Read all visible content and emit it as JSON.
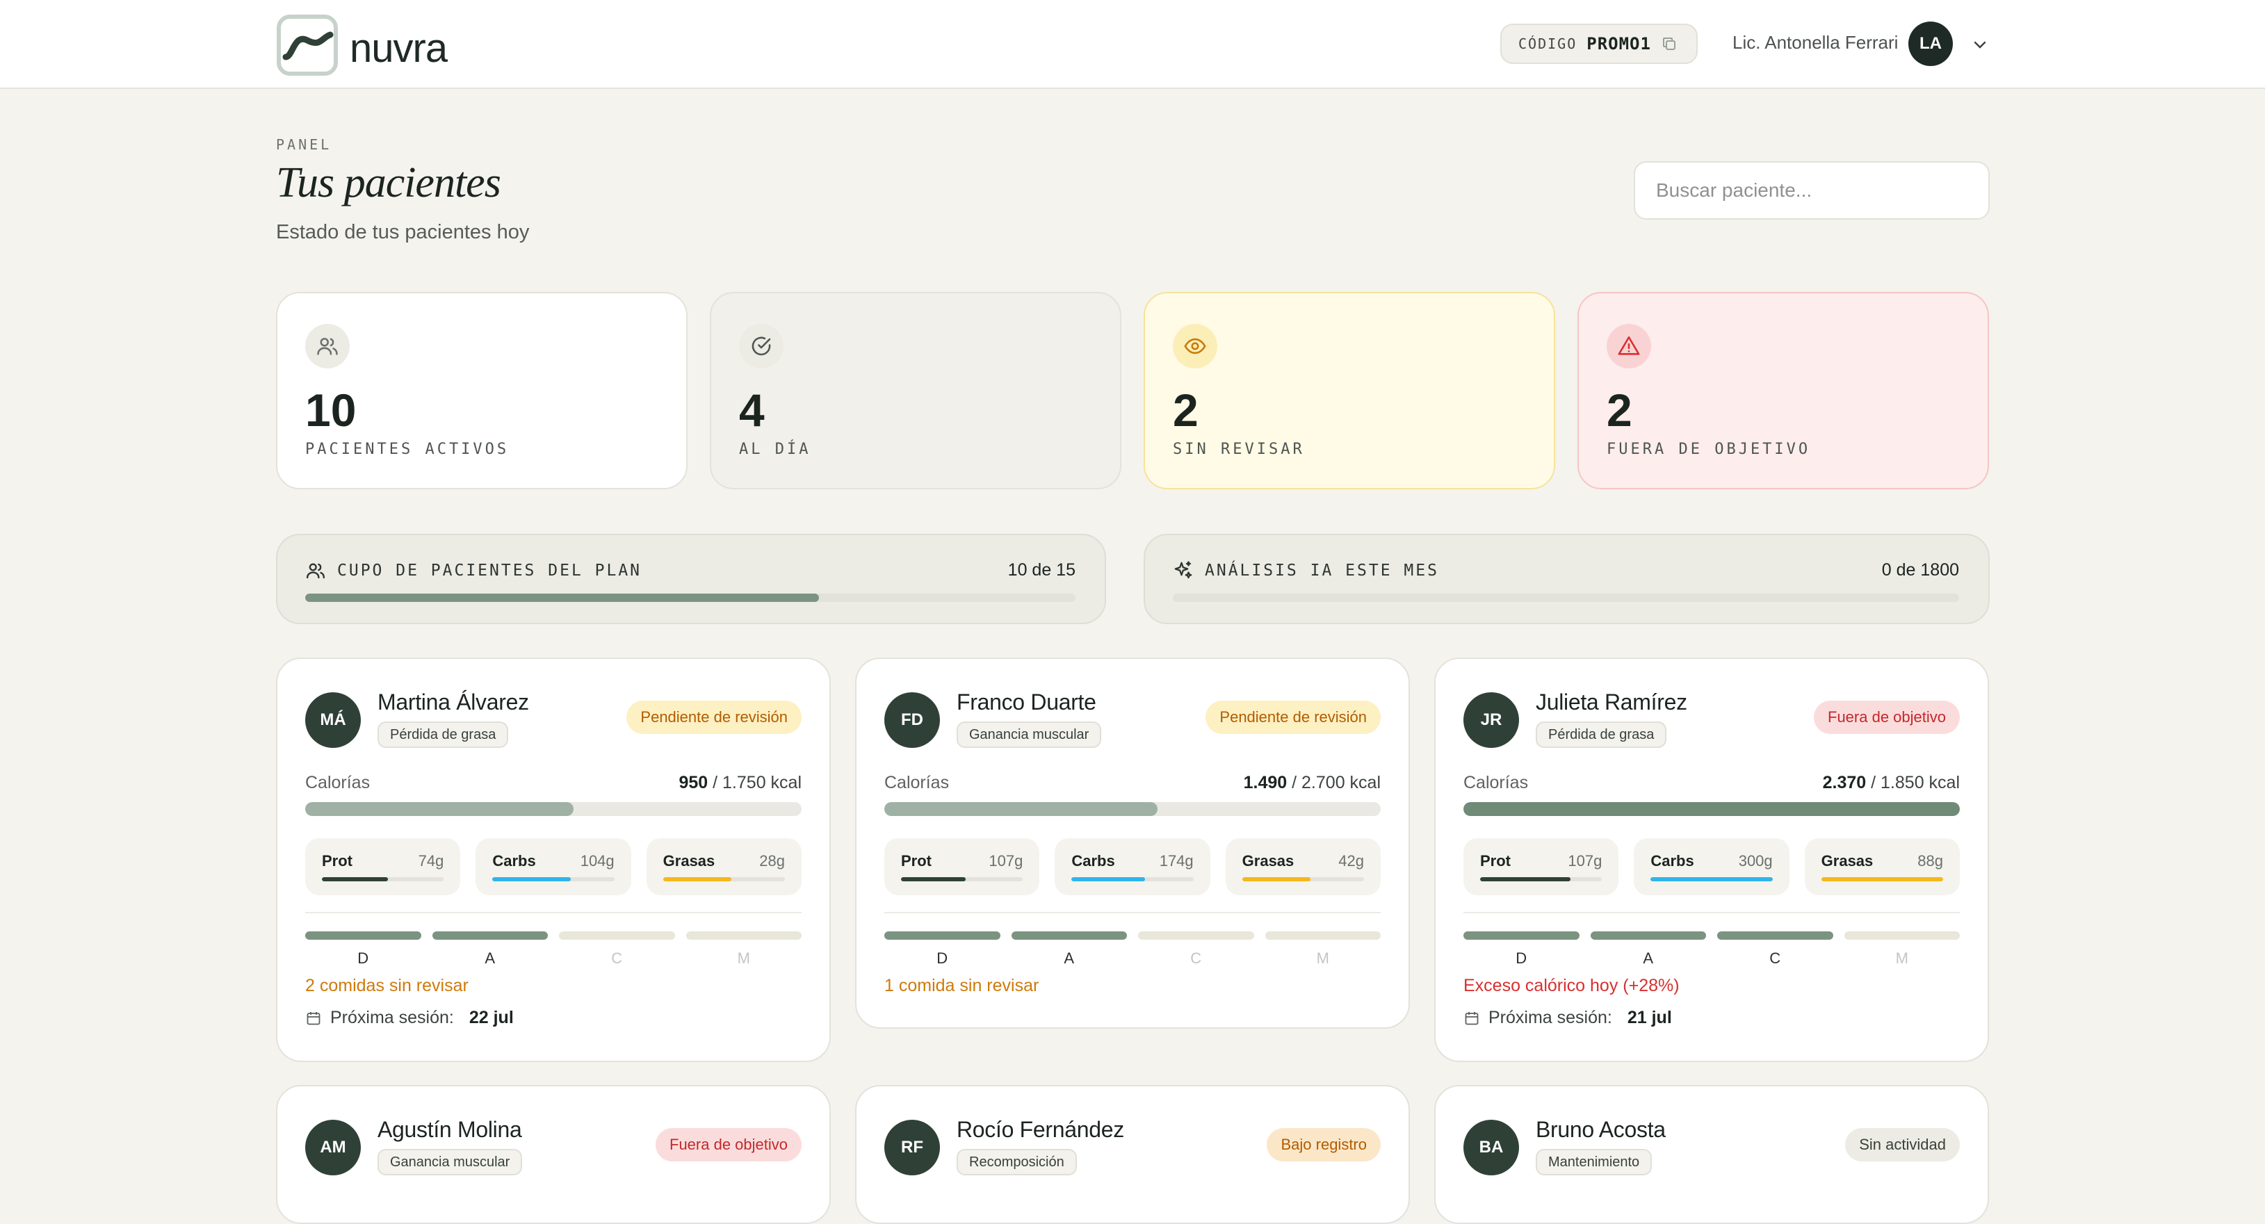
{
  "brand": {
    "name": "nuvra"
  },
  "header": {
    "code_label": "CÓDIGO",
    "code_value": "PROMO1",
    "user_name": "Lic. Antonella Ferrari",
    "user_initials": "LA"
  },
  "panel": {
    "eyebrow": "PANEL",
    "title": "Tus pacientes",
    "subtitle": "Estado de tus pacientes hoy",
    "search_placeholder": "Buscar paciente..."
  },
  "stats": [
    {
      "value": "10",
      "label": "PACIENTES ACTIVOS",
      "icon": "users-icon"
    },
    {
      "value": "4",
      "label": "AL DÍA",
      "icon": "check-circle-icon"
    },
    {
      "value": "2",
      "label": "SIN REVISAR",
      "icon": "eye-icon"
    },
    {
      "value": "2",
      "label": "FUERA DE OBJETIVO",
      "icon": "warning-icon"
    }
  ],
  "quotas": [
    {
      "label": "CUPO DE PACIENTES DEL PLAN",
      "value": "10 de 15",
      "fraction": 0.667,
      "icon": "users-icon"
    },
    {
      "label": "ANÁLISIS IA ESTE MES",
      "value": "0 de 1800",
      "fraction": 0,
      "icon": "sparkles-icon"
    }
  ],
  "meal_letters": [
    "D",
    "A",
    "C",
    "M"
  ],
  "session_label": "Próxima sesión:",
  "calories_label": "Calorías",
  "patients": [
    {
      "initials": "MÁ",
      "name": "Martina Álvarez",
      "tag": "Pérdida de grasa",
      "status": "Pendiente de revisión",
      "kcal": "950",
      "kcal_goal": "/ 1.750 kcal",
      "kcal_fraction": 0.54,
      "macros": [
        {
          "name": "Prot",
          "value": "74g",
          "fraction": 0.54
        },
        {
          "name": "Carbs",
          "value": "104g",
          "fraction": 0.64
        },
        {
          "name": "Grasas",
          "value": "28g",
          "fraction": 0.56
        }
      ],
      "meals_done": [
        true,
        true,
        false,
        false
      ],
      "alert": "2 comidas sin revisar",
      "session_date": "22 jul"
    },
    {
      "initials": "FD",
      "name": "Franco Duarte",
      "tag": "Ganancia muscular",
      "status": "Pendiente de revisión",
      "kcal": "1.490",
      "kcal_goal": "/ 2.700 kcal",
      "kcal_fraction": 0.55,
      "macros": [
        {
          "name": "Prot",
          "value": "107g",
          "fraction": 0.53
        },
        {
          "name": "Carbs",
          "value": "174g",
          "fraction": 0.6
        },
        {
          "name": "Grasas",
          "value": "42g",
          "fraction": 0.56
        }
      ],
      "meals_done": [
        true,
        true,
        false,
        false
      ],
      "alert": "1 comida sin revisar",
      "session_date": ""
    },
    {
      "initials": "JR",
      "name": "Julieta Ramírez",
      "tag": "Pérdida de grasa",
      "status": "Fuera de objetivo",
      "kcal": "2.370",
      "kcal_goal": "/ 1.850 kcal",
      "kcal_fraction": 1,
      "macros": [
        {
          "name": "Prot",
          "value": "107g",
          "fraction": 0.74
        },
        {
          "name": "Carbs",
          "value": "300g",
          "fraction": 1
        },
        {
          "name": "Grasas",
          "value": "88g",
          "fraction": 1
        }
      ],
      "meals_done": [
        true,
        true,
        true,
        false
      ],
      "alert": "Exceso calórico hoy (+28%)",
      "session_date": "21 jul"
    },
    {
      "initials": "AM",
      "name": "Agustín Molina",
      "tag": "Ganancia muscular",
      "status": "Fuera de objetivo"
    },
    {
      "initials": "RF",
      "name": "Rocío Fernández",
      "tag": "Recomposición",
      "status": "Bajo registro"
    },
    {
      "initials": "BA",
      "name": "Bruno Acosta",
      "tag": "Mantenimiento",
      "status": "Sin actividad"
    }
  ],
  "colors": {
    "accent": "#7b9481",
    "protein": "#2f4137",
    "carbs": "#2fb5ea",
    "fat": "#f5b81c",
    "warning": "#cf7a0a",
    "danger": "#d8302f"
  }
}
